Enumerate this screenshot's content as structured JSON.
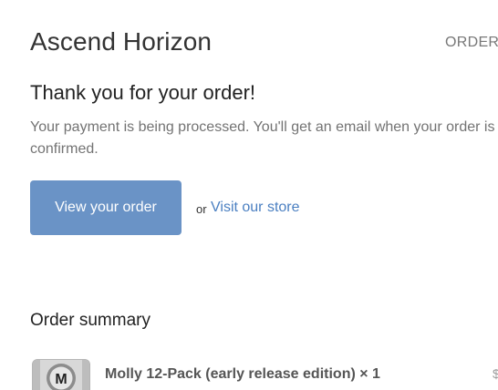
{
  "header": {
    "shop_name": "Ascend Horizon",
    "order_number": "ORDER #"
  },
  "confirmation": {
    "heading": "Thank you for your order!",
    "message": "Your payment is being processed. You'll get an email when your order is confirmed."
  },
  "actions": {
    "view_order_label": "View your order",
    "or_text": "or",
    "visit_store_label": "Visit our store"
  },
  "summary": {
    "heading": "Order summary",
    "items": [
      {
        "title": "Molly 12-Pack (early release edition) × 1",
        "thumbnail_letter": "M",
        "price": "$"
      }
    ]
  },
  "colors": {
    "button_background": "#6a93c6",
    "link": "#4a7fc1"
  }
}
